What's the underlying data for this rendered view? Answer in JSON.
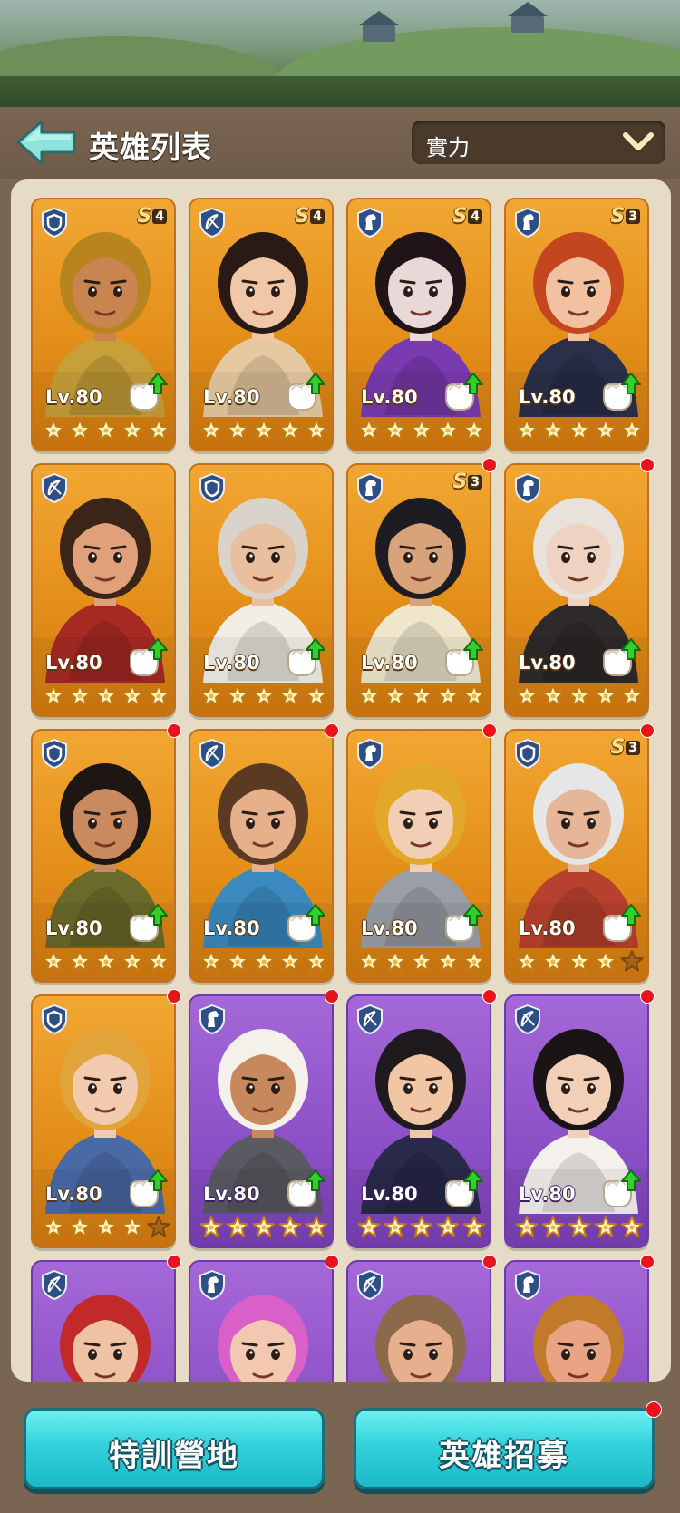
{
  "header": {
    "title": "英雄列表",
    "sort_value": "實力"
  },
  "buttons": {
    "training": "特訓營地",
    "recruit": "英雄招募"
  },
  "heroes": [
    {
      "rarity": "gold",
      "class": "shield",
      "rank": "S",
      "rank_num": "4",
      "level": "Lv.80",
      "stars": 5,
      "upgrade": true,
      "badge": false,
      "hair": "#b8841f",
      "skin": "#c8854f",
      "outfit": "#c8a03a"
    },
    {
      "rarity": "gold",
      "class": "bow",
      "rank": "S",
      "rank_num": "4",
      "level": "Lv.80",
      "stars": 5,
      "upgrade": true,
      "badge": false,
      "hair": "#2a1a16",
      "skin": "#f0c8a8",
      "outfit": "#e6c9a0"
    },
    {
      "rarity": "gold",
      "class": "horse",
      "rank": "S",
      "rank_num": "4",
      "level": "Lv.80",
      "stars": 5,
      "upgrade": true,
      "badge": false,
      "hair": "#201418",
      "skin": "#e9d8d8",
      "outfit": "#7a3bb0"
    },
    {
      "rarity": "gold",
      "class": "horse",
      "rank": "S",
      "rank_num": "3",
      "level": "Lv.80",
      "stars": 5,
      "upgrade": true,
      "badge": false,
      "hair": "#c4461e",
      "skin": "#f2c2a0",
      "outfit": "#2b2f4a"
    },
    {
      "rarity": "gold",
      "class": "bow",
      "rank": "",
      "rank_num": "",
      "level": "Lv.80",
      "stars": 5,
      "upgrade": true,
      "badge": false,
      "hair": "#3b2418",
      "skin": "#e0a07a",
      "outfit": "#a62a22"
    },
    {
      "rarity": "gold",
      "class": "shield",
      "rank": "",
      "rank_num": "",
      "level": "Lv.80",
      "stars": 5,
      "upgrade": true,
      "badge": false,
      "hair": "#d8d4cc",
      "skin": "#e8c0a0",
      "outfit": "#f2eee6"
    },
    {
      "rarity": "gold",
      "class": "horse",
      "rank": "S",
      "rank_num": "3",
      "level": "Lv.80",
      "stars": 5,
      "upgrade": true,
      "badge": true,
      "hair": "#1c1c22",
      "skin": "#d8a27a",
      "outfit": "#f0e6cc"
    },
    {
      "rarity": "gold",
      "class": "horse",
      "rank": "",
      "rank_num": "",
      "level": "Lv.80",
      "stars": 5,
      "upgrade": true,
      "badge": true,
      "hair": "#e8e2da",
      "skin": "#eed2c2",
      "outfit": "#2e2a2a"
    },
    {
      "rarity": "gold",
      "class": "shield",
      "rank": "",
      "rank_num": "",
      "level": "Lv.80",
      "stars": 5,
      "upgrade": true,
      "badge": true,
      "hair": "#1e1612",
      "skin": "#c88a5e",
      "outfit": "#6b6a2a"
    },
    {
      "rarity": "gold",
      "class": "bow",
      "rank": "",
      "rank_num": "",
      "level": "Lv.80",
      "stars": 5,
      "upgrade": true,
      "badge": true,
      "hair": "#5a3a22",
      "skin": "#e6b08a",
      "outfit": "#3a8ac0"
    },
    {
      "rarity": "gold",
      "class": "horse",
      "rank": "",
      "rank_num": "",
      "level": "Lv.80",
      "stars": 5,
      "upgrade": true,
      "badge": true,
      "hair": "#e2a82a",
      "skin": "#f2cfb4",
      "outfit": "#9a9ea6"
    },
    {
      "rarity": "gold",
      "class": "shield",
      "rank": "S",
      "rank_num": "3",
      "level": "Lv.80",
      "stars": 4,
      "upgrade": true,
      "badge": true,
      "hair": "#e6e6e6",
      "skin": "#e6b698",
      "outfit": "#b8402e"
    },
    {
      "rarity": "gold",
      "class": "shield",
      "rank": "",
      "rank_num": "",
      "level": "Lv.80",
      "stars": 4,
      "upgrade": true,
      "badge": true,
      "hair": "#e0a43a",
      "skin": "#f2cab0",
      "outfit": "#4a6aa6"
    },
    {
      "rarity": "purple",
      "class": "horse",
      "rank": "",
      "rank_num": "",
      "level": "Lv.80",
      "stars": 5,
      "upgrade": true,
      "badge": true,
      "hair": "#f4f0ea",
      "skin": "#c8885e",
      "outfit": "#5a5a62"
    },
    {
      "rarity": "purple",
      "class": "bow",
      "rank": "",
      "rank_num": "",
      "level": "Lv.80",
      "stars": 5,
      "upgrade": true,
      "badge": true,
      "hair": "#1e1a1e",
      "skin": "#f0c6a4",
      "outfit": "#2a2a4a"
    },
    {
      "rarity": "purple",
      "class": "bow",
      "rank": "",
      "rank_num": "",
      "level": "Lv.80",
      "stars": 5,
      "upgrade": true,
      "badge": true,
      "hair": "#1a1416",
      "skin": "#f2d0b8",
      "outfit": "#f4f0ec"
    },
    {
      "rarity": "purple",
      "class": "bow",
      "rank": "",
      "rank_num": "",
      "level": "",
      "stars": 0,
      "upgrade": false,
      "badge": true,
      "hair": "#c22a2a",
      "skin": "#f0c2a4",
      "outfit": "#8a3a2a"
    },
    {
      "rarity": "purple",
      "class": "horse",
      "rank": "",
      "rank_num": "",
      "level": "",
      "stars": 0,
      "upgrade": false,
      "badge": true,
      "hair": "#d860c8",
      "skin": "#f2c8b0",
      "outfit": "#e0b03a"
    },
    {
      "rarity": "purple",
      "class": "bow",
      "rank": "",
      "rank_num": "",
      "level": "",
      "stars": 0,
      "upgrade": false,
      "badge": true,
      "hair": "#8a6a4a",
      "skin": "#e6b08e",
      "outfit": "#4a4a52"
    },
    {
      "rarity": "purple",
      "class": "horse",
      "rank": "",
      "rank_num": "",
      "level": "",
      "stars": 0,
      "upgrade": false,
      "badge": true,
      "hair": "#c07a2a",
      "skin": "#e8a484",
      "outfit": "#c04a2a"
    }
  ],
  "colors": {
    "gold_card": "#e8951f",
    "purple_card": "#8e52c8",
    "badge": "#e8141c",
    "button": "#33d1dc"
  }
}
